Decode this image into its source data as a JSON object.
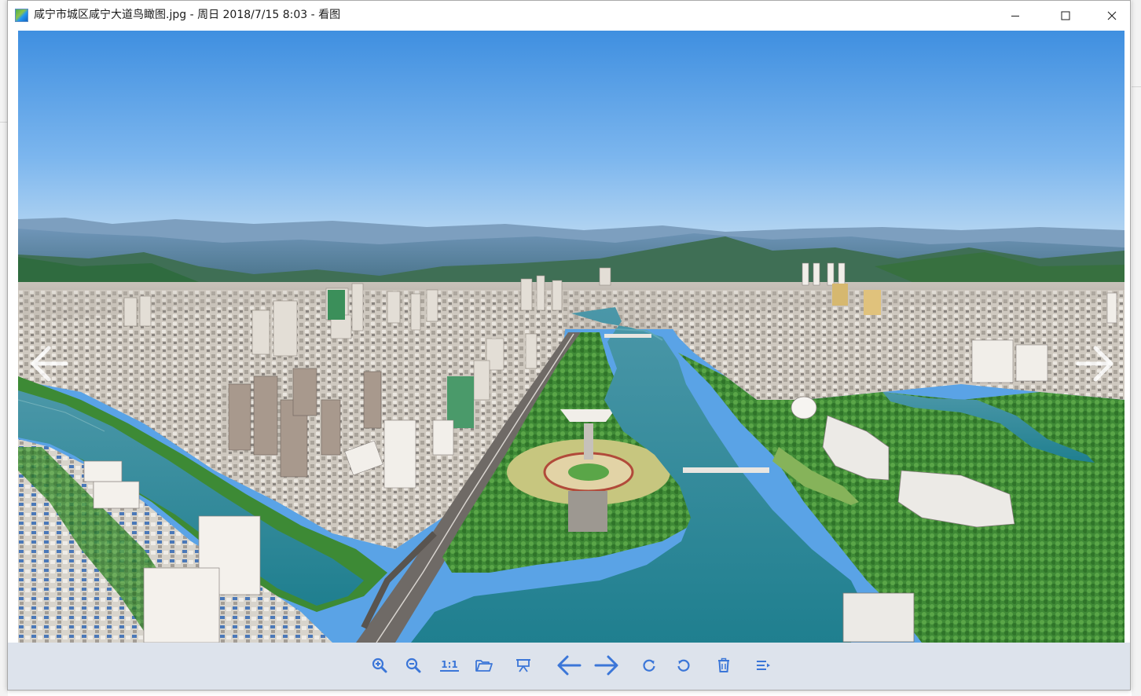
{
  "window": {
    "title": "咸宁市城区咸宁大道鸟瞰图.jpg - 周日 2018/7/15 8:03 - 看图",
    "icon": "image-viewer-app-icon"
  },
  "window_controls": {
    "minimize": "minimize-icon",
    "maximize": "maximize-icon",
    "close": "close-icon"
  },
  "viewer": {
    "image_alt": "aerial-city-river-photo",
    "prev_icon": "arrow-left-icon",
    "next_icon": "arrow-right-icon"
  },
  "toolbar": {
    "zoom_in": "zoom-in-icon",
    "zoom_out": "zoom-out-icon",
    "actual_size_label": "1:1",
    "open_folder": "folder-open-icon",
    "slideshow": "slideshow-icon",
    "previous": "arrow-left-icon",
    "next": "arrow-right-icon",
    "rotate_right": "rotate-clockwise-icon",
    "rotate_left": "rotate-counterclockwise-icon",
    "delete": "trash-icon",
    "more": "menu-more-icon"
  },
  "colors": {
    "accent": "#3b76d8",
    "toolbar_bg": "#dde3ec",
    "sky_top": "#3f8fe0",
    "river": "#2a8a9a",
    "vegetation": "#3d8a35"
  }
}
